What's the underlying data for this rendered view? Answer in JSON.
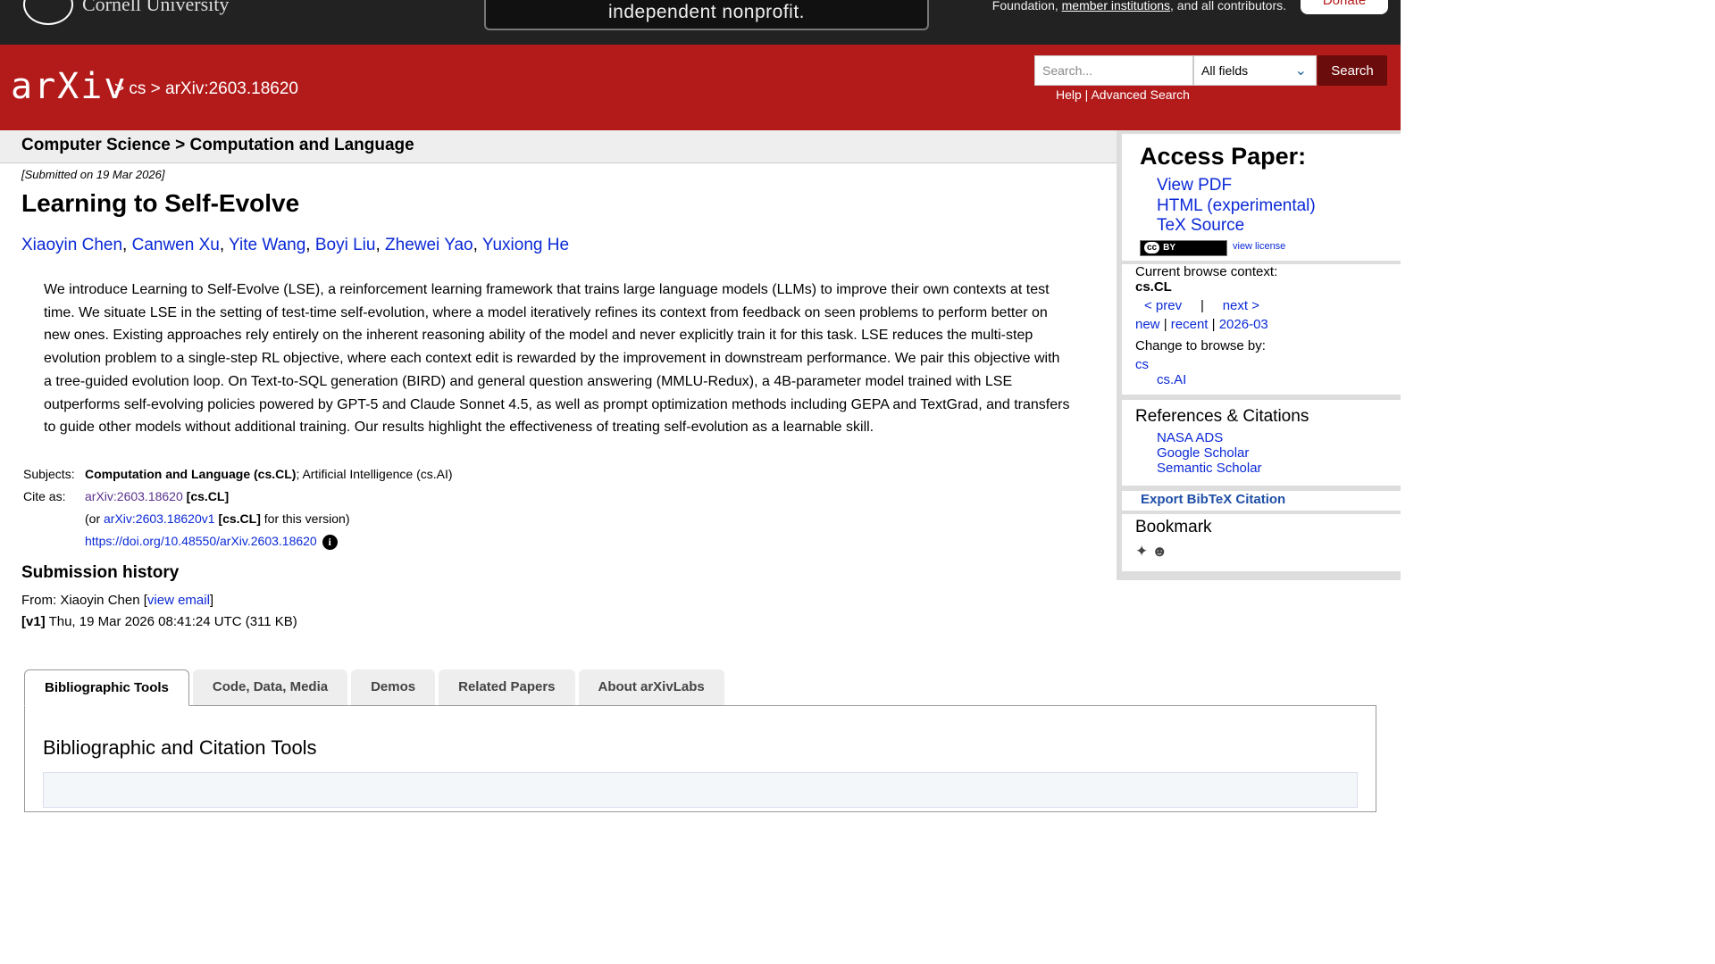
{
  "topbar": {
    "institution": "Cornell University",
    "banner_text": "independent nonprofit.",
    "support_text_before": "Foundation, ",
    "support_link": "member institutions",
    "support_text_after": ", and all contributors.",
    "donate_label": "Donate"
  },
  "header": {
    "logo_text": "arXiv",
    "breadcrumb": "> cs > arXiv:2603.18620",
    "search_placeholder": "Search...",
    "field_select": "All fields",
    "search_button": "Search",
    "help_label": "Help",
    "help_sep": " | ",
    "advanced_label": "Advanced Search"
  },
  "subject_header": "Computer Science > Computation and Language",
  "paper": {
    "submitted": "[Submitted on 19 Mar 2026]",
    "title": "Learning to Self-Evolve",
    "authors": [
      "Xiaoyin Chen",
      "Canwen Xu",
      "Yite Wang",
      "Boyi Liu",
      "Zhewei Yao",
      "Yuxiong He"
    ],
    "abstract": "We introduce Learning to Self-Evolve (LSE), a reinforcement learning framework that trains large language models (LLMs) to improve their own contexts at test time. We situate LSE in the setting of test-time self-evolution, where a model iteratively refines its context from feedback on seen problems to perform better on new ones. Existing approaches rely entirely on the inherent reasoning ability of the model and never explicitly train it for this task. LSE reduces the multi-step evolution problem to a single-step RL objective, where each context edit is rewarded by the improvement in downstream performance. We pair this objective with a tree-guided evolution loop. On Text-to-SQL generation (BIRD) and general question answering (MMLU-Redux), a 4B-parameter model trained with LSE outperforms self-evolving policies powered by GPT-5 and Claude Sonnet 4.5, as well as prompt optimization methods including GEPA and TextGrad, and transfers to guide other models without additional training. Our results highlight the effectiveness of treating self-evolution as a learnable skill."
  },
  "meta": {
    "subjects_label": "Subjects:",
    "subjects_primary": "Computation and Language (cs.CL)",
    "subjects_rest": "; Artificial Intelligence (cs.AI)",
    "cite_label": "Cite as:",
    "cite_id": "arXiv:2603.18620",
    "cite_cat": "[cs.CL]",
    "cite_or_prefix": "(or ",
    "cite_version": "arXiv:2603.18620v1",
    "cite_or_suffix": " for this version)",
    "doi": "https://doi.org/10.48550/arXiv.2603.18620",
    "info_icon": "info-icon"
  },
  "history": {
    "heading": "Submission history",
    "from_prefix": "From: Xiaoyin Chen [",
    "view_email": "view email",
    "from_suffix": "]",
    "v1_label": "[v1]",
    "v1_text": " Thu, 19 Mar 2026 08:41:24 UTC (311 KB)"
  },
  "tabs": [
    {
      "label": "Bibliographic Tools",
      "active": true
    },
    {
      "label": "Code, Data, Media",
      "active": false
    },
    {
      "label": "Demos",
      "active": false
    },
    {
      "label": "Related Papers",
      "active": false
    },
    {
      "label": "About arXivLabs",
      "active": false
    }
  ],
  "tab_panel_heading": "Bibliographic and Citation Tools",
  "sidebar": {
    "access_heading": "Access Paper:",
    "access_links": [
      "View PDF",
      "HTML (experimental)",
      "TeX Source"
    ],
    "license_badge": "BY",
    "view_license": "view license",
    "context_label": "Current browse context:",
    "context_value": "cs.CL",
    "prev": "< prev",
    "nav_sep": "|",
    "next": "next >",
    "new": "new",
    "recent": "recent",
    "month": "2026-03",
    "change_label": "Change to browse by:",
    "browse_cs": "cs",
    "browse_csai": "cs.AI",
    "refs_heading": "References & Citations",
    "refs": [
      "NASA ADS",
      "Google Scholar",
      "Semantic Scholar"
    ],
    "bibtex": "Export BibTeX Citation",
    "bookmark_heading": "Bookmark"
  },
  "colors": {
    "header_red": "#b31b1b",
    "link_blue": "#0b29d6",
    "topbar": "#222222"
  }
}
